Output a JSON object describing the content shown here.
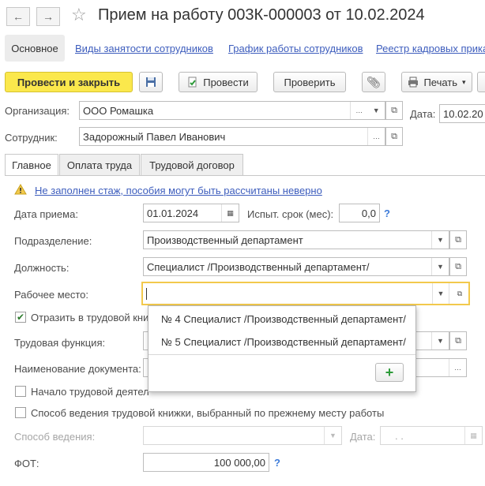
{
  "window": {
    "title": "Прием на работу 003К-000003 от 10.02.2024",
    "back_icon": "arrow-left-icon",
    "forward_icon": "arrow-right-icon",
    "favorite_icon": "star-icon"
  },
  "nav": {
    "tabs": [
      {
        "label": "Основное"
      },
      {
        "label": "Виды занятости сотрудников"
      },
      {
        "label": "График работы сотрудников"
      },
      {
        "label": "Реестр кадровых прика"
      }
    ]
  },
  "toolbar": {
    "post_close": "Провести и закрыть",
    "post": "Провести",
    "check": "Проверить",
    "print": "Печать"
  },
  "header": {
    "org_label": "Организация:",
    "org_value": "ООО Ромашка",
    "date_label": "Дата:",
    "date_value": "10.02.20",
    "employee_label": "Сотрудник:",
    "employee_value": "Задорожный Павел Иванович"
  },
  "subtabs": [
    {
      "label": "Главное"
    },
    {
      "label": "Оплата труда"
    },
    {
      "label": "Трудовой договор"
    }
  ],
  "warning": {
    "text": "Не заполнен стаж, пособия могут быть рассчитаны неверно",
    "color": "#f2c94c"
  },
  "form": {
    "hire_date_label": "Дата приема:",
    "hire_date_value": "01.01.2024",
    "probation_label": "Испыт. срок (мес):",
    "probation_value": "0,0",
    "dept_label": "Подразделение:",
    "dept_value": "Производственный департамент",
    "position_label": "Должность:",
    "position_value": "Специалист /Производственный департамент/",
    "workplace_label": "Рабочее место:",
    "workplace_value": "",
    "reflect_label": "Отразить в трудовой кни",
    "reflect_checked": true,
    "labor_function_label": "Трудовая функция:",
    "doc_name_label": "Наименование документа:",
    "work_start_label": "Начало трудовой деятел",
    "work_start_checked": false,
    "method_prev_label": "Способ ведения трудовой книжки, выбранный по прежнему месту работы",
    "method_prev_checked": false,
    "method_label": "Способ ведения:",
    "method_date_label": "Дата:",
    "method_date_value": ". .",
    "fot_label": "ФОТ:",
    "fot_value": "100 000,00"
  },
  "dropdown": {
    "items": [
      "№ 4 Специалист /Производственный департамент/",
      "№ 5 Специалист /Производственный департамент/"
    ],
    "add_label": "+"
  },
  "colors": {
    "accent": "#fbe84c",
    "link": "#3d5dbd"
  }
}
